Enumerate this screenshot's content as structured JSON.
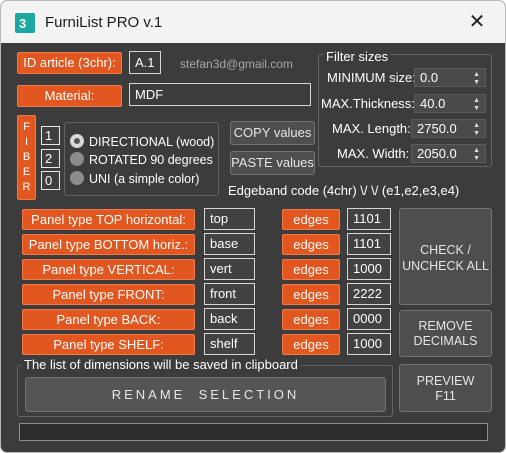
{
  "window": {
    "title": "FurniList PRO v.1",
    "icon": "3ds-max-app-icon",
    "close_icon": "close-icon"
  },
  "article": {
    "label": "ID article (3chr):",
    "value": "A.1",
    "email": "stefan3d@gmail.com"
  },
  "material": {
    "label": "Material:",
    "value": "MDF"
  },
  "filter": {
    "title": "Filter sizes",
    "min_size_label": "MINIMUM size:",
    "min_size_value": "0.0",
    "max_thickness_label": "MAX.Thickness:",
    "max_thickness_value": "40.0",
    "max_length_label": "MAX. Length:",
    "max_length_value": "2750.0",
    "max_width_label": "MAX. Width:",
    "max_width_value": "2050.0"
  },
  "fiber": {
    "letters": [
      "F",
      "I",
      "B",
      "E",
      "R"
    ],
    "options": [
      {
        "num": "1",
        "label": "DIRECTIONAL (wood)",
        "selected": true
      },
      {
        "num": "2",
        "label": "ROTATED 90 degrees",
        "selected": false
      },
      {
        "num": "0",
        "label": "UNI (a simple color)",
        "selected": false
      }
    ]
  },
  "buttons": {
    "copy": "COPY values",
    "paste": "PASTE values",
    "check_uncheck": "CHECK / UNCHECK ALL",
    "check_line1": "CHECK /",
    "check_line2": "UNCHECK ALL",
    "remove_line1": "REMOVE",
    "remove_line2": "DECIMALS",
    "preview_line1": "PREVIEW",
    "preview_line2": "F11",
    "rename": "RENAME  SELECTION"
  },
  "edgeband": {
    "label": "Edgeband code (4chr) \\/ \\/  (e1,e2,e3,e4)"
  },
  "panels": [
    {
      "label": "Panel type TOP horizontal:",
      "name": "top",
      "edges_label": "edges",
      "edges": "1101"
    },
    {
      "label": "Panel type BOTTOM horiz.:",
      "name": "base",
      "edges_label": "edges",
      "edges": "1101"
    },
    {
      "label": "Panel type VERTICAL:",
      "name": "vert",
      "edges_label": "edges",
      "edges": "1000"
    },
    {
      "label": "Panel type FRONT:",
      "name": "front",
      "edges_label": "edges",
      "edges": "2222"
    },
    {
      "label": "Panel type BACK:",
      "name": "back",
      "edges_label": "edges",
      "edges": "0000"
    },
    {
      "label": "Panel type SHELF:",
      "name": "shelf",
      "edges_label": "edges",
      "edges": "1000"
    }
  ],
  "clipboard_note": "The list of dimensions will be saved in clipboard",
  "colors": {
    "accent": "#e2561f",
    "background": "#3c3c3c",
    "titlebar": "#f3f3f3"
  }
}
